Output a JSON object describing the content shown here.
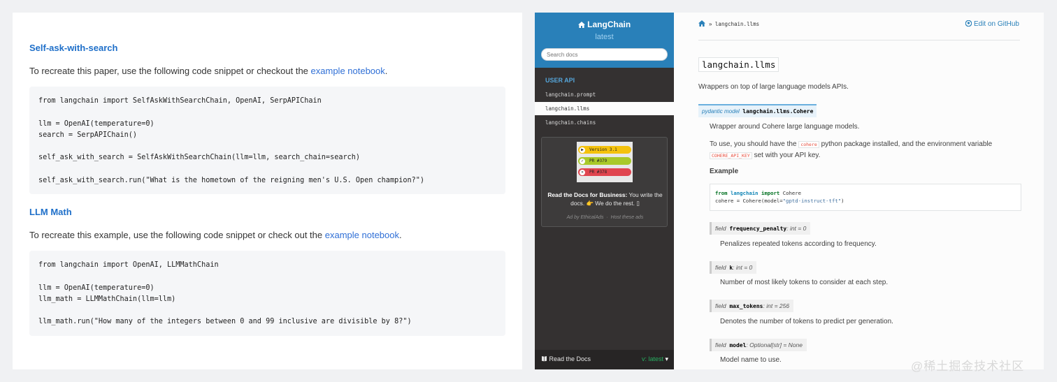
{
  "left": {
    "section1": {
      "heading": "Self-ask-with-search",
      "intro": "To recreate this paper, use the following code snippet or checkout the ",
      "link": "example notebook",
      "after": ".",
      "code": "from langchain import SelfAskWithSearchChain, OpenAI, SerpAPIChain\n\nllm = OpenAI(temperature=0)\nsearch = SerpAPIChain()\n\nself_ask_with_search = SelfAskWithSearchChain(llm=llm, search_chain=search)\n\nself_ask_with_search.run(\"What is the hometown of the reigning men's U.S. Open champion?\")"
    },
    "section2": {
      "heading": "LLM Math",
      "intro": "To recreate this example, use the following code snippet or check out the ",
      "link": "example notebook",
      "after": ".",
      "code": "from langchain import OpenAI, LLMMathChain\n\nllm = OpenAI(temperature=0)\nllm_math = LLMMathChain(llm=llm)\n\nllm_math.run(\"How many of the integers between 0 and 99 inclusive are divisible by 8?\")"
    }
  },
  "sidebar": {
    "brand": "LangChain",
    "brand_icon": "home-icon",
    "version": "latest",
    "search_placeholder": "Search docs",
    "caption": "USER API",
    "nav": [
      "langchain.prompt",
      "langchain.llms",
      "langchain.chains"
    ],
    "active_index": 1,
    "ad": {
      "badges": [
        {
          "label": "Version 3.1",
          "color": "#f4c20d",
          "icon": "play-icon"
        },
        {
          "label": "PR #379",
          "color": "#a9c92a",
          "icon": "check-icon"
        },
        {
          "label": "PR #378",
          "color": "#e0454f",
          "icon": "x-icon"
        }
      ],
      "bold": "Read the Docs for Business:",
      "text": " You write the docs. 👉 We do the rest. ▯",
      "by": "Ad by EthicalAds",
      "sep": "·",
      "host": "Host these ads"
    },
    "footer": {
      "label": "Read the Docs",
      "version": "v: latest"
    }
  },
  "doc": {
    "breadcrumb_sep": "»",
    "breadcrumb": "langchain.llms",
    "edit": "Edit on GitHub",
    "title": "langchain.llms",
    "description": "Wrappers on top of large language models APIs.",
    "class_prefix": "pydantic model",
    "class_name": "langchain.llms.Cohere",
    "class_desc": "Wrapper around Cohere large language models.",
    "usage_1": "To use, you should have the ",
    "usage_lit1": "cohere",
    "usage_2": " python package installed, and the environment variable",
    "usage_lit2": "COHERE_API_KEY",
    "usage_3": " set with your API key.",
    "example_heading": "Example",
    "example_code": {
      "from": "from",
      "module": "langchain",
      "import": "import",
      "cls": "Cohere",
      "line2a": "cohere = Cohere(model=",
      "line2s": "\"gptd-instruct-tft\"",
      "line2b": ")"
    },
    "fields": [
      {
        "kw": "field",
        "name": "frequency_penalty",
        "type": ": int",
        "default": " = 0",
        "desc": "Penalizes repeated tokens according to frequency."
      },
      {
        "kw": "field",
        "name": "k",
        "type": ": int",
        "default": " = 0",
        "desc": "Number of most likely tokens to consider at each step."
      },
      {
        "kw": "field",
        "name": "max_tokens",
        "type": ": int",
        "default": " = 256",
        "desc": "Denotes the number of tokens to predict per generation."
      },
      {
        "kw": "field",
        "name": "model",
        "type": ": Optional[str]",
        "default": " = None",
        "desc": "Model name to use."
      }
    ]
  },
  "watermark": "@稀土掘金技术社区"
}
